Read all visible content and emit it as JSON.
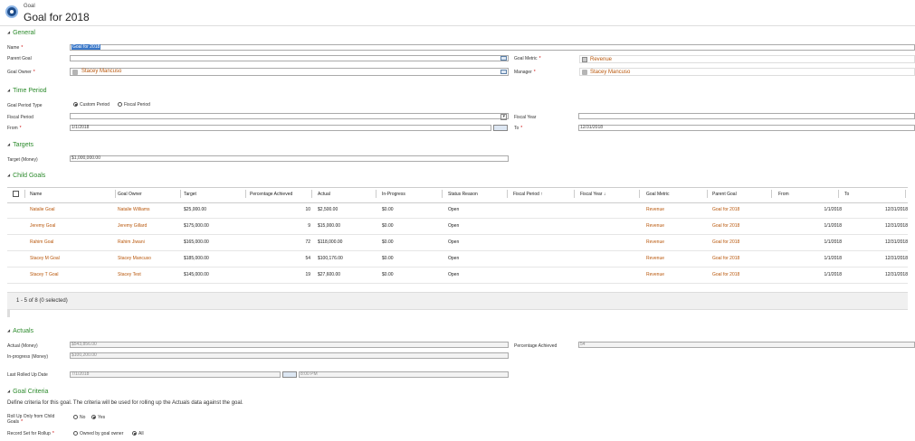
{
  "header": {
    "entity": "Goal",
    "title": "Goal for 2018"
  },
  "general": {
    "section": "General",
    "name_label": "Name",
    "name_value": "Goal for 2018",
    "parent_goal_label": "Parent Goal",
    "goal_metric_label": "Goal Metric",
    "goal_metric_value": "Revenue",
    "goal_owner_label": "Goal Owner",
    "goal_owner_value": "Stacey Mancuso",
    "manager_label": "Manager",
    "manager_value": "Stacey Mancuso"
  },
  "time": {
    "section": "Time Period",
    "period_type_label": "Goal Period Type",
    "custom": "Custom Period",
    "fiscal": "Fiscal Period",
    "fiscal_period_label": "Fiscal Period",
    "fiscal_year_label": "Fiscal Year",
    "from_label": "From",
    "from_value": "1/1/2018",
    "to_label": "To",
    "to_value": "12/31/2018"
  },
  "targets": {
    "section": "Targets",
    "target_label": "Target (Money)",
    "target_value": "$1,000,000.00"
  },
  "child": {
    "section": "Child Goals",
    "columns": [
      "Name",
      "Goal Owner",
      "Target",
      "Percentage Achieved",
      "Actual",
      "In-Progress",
      "Status Reason",
      "Fiscal Period ↑",
      "Fiscal Year ↓",
      "Goal Metric",
      "Parent Goal",
      "From",
      "To"
    ],
    "rows": [
      [
        "Natalie Goal",
        "Natalie Williams",
        "$25,000.00",
        "10",
        "$2,500.00",
        "$0.00",
        "Open",
        "",
        "",
        "Revenue",
        "Goal for 2018",
        "1/1/2018",
        "12/31/2018"
      ],
      [
        "Jeremy Goal",
        "Jeremy Gillard",
        "$175,000.00",
        "9",
        "$15,000.00",
        "$0.00",
        "Open",
        "",
        "",
        "Revenue",
        "Goal for 2018",
        "1/1/2018",
        "12/31/2018"
      ],
      [
        "Rahim Goal",
        "Rahim Jiwani",
        "$165,000.00",
        "72",
        "$118,000.00",
        "$0.00",
        "Open",
        "",
        "",
        "Revenue",
        "Goal for 2018",
        "1/1/2018",
        "12/31/2018"
      ],
      [
        "Stacey M Goal",
        "Stacey Mancuso",
        "$185,000.00",
        "54",
        "$100,176.00",
        "$0.00",
        "Open",
        "",
        "",
        "Revenue",
        "Goal for 2018",
        "1/1/2018",
        "12/31/2018"
      ],
      [
        "Stacey T Goal",
        "Stacey Test",
        "$145,000.00",
        "19",
        "$27,600.00",
        "$0.00",
        "Open",
        "",
        "",
        "Revenue",
        "Goal for 2018",
        "1/1/2018",
        "12/31/2018"
      ]
    ],
    "footer": "1 - 5 of 8 (0 selected)"
  },
  "actuals": {
    "section": "Actuals",
    "actual_label": "Actual (Money)",
    "actual_value": "$543,856.00",
    "pct_label": "Percentage Achieved",
    "pct_value": "54",
    "inprog_label": "In-progress (Money)",
    "inprog_value": "$100,200.00",
    "rolled_label": "Last Rolled Up Date",
    "rolled_date": "7/1/2018",
    "rolled_time": "8:00 PM"
  },
  "criteria": {
    "section": "Goal Criteria",
    "desc": "Define criteria for this goal. The criteria will be used for rolling up the Actuals data against the goal.",
    "rollup_label": "Roll Up Only from Child Goals",
    "no": "No",
    "yes": "Yes",
    "recordset_label": "Record Set for Rollup",
    "owned": "Owned by goal owner",
    "all": "All"
  }
}
